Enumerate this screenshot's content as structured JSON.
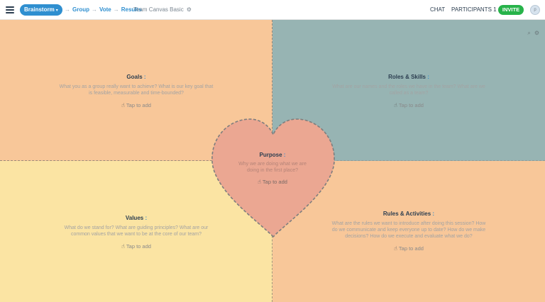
{
  "header": {
    "stage_label": "Brainstorm",
    "crumbs": [
      "Group",
      "Vote",
      "Results"
    ],
    "board_name": "Team Canvas Basic",
    "chat": "CHAT",
    "participants": "PARTICIPANTS 1",
    "invite": "INVITE",
    "avatar_initials": "p"
  },
  "sections": {
    "goals": {
      "title": "Goals",
      "desc": "What you as a group really want to achieve? What is our key goal that is feasible, measurable and time-bounded?",
      "tap": "Tap to add"
    },
    "roles": {
      "title": "Roles & Skills",
      "desc": "What are our names and the roles we have in the team? What are we called as a team?",
      "tap": "Tap to add"
    },
    "values": {
      "title": "Values",
      "desc": "What do we stand for? What are guiding principles? What are our common values that we want to be at the core of our team?",
      "tap": "Tap to add"
    },
    "rules": {
      "title": "Rules & Activities",
      "desc": "What are the rules we want to introduce after doing this session? How do we communicate and keep everyone up to date? How do we make decisions? How do we execute and evaluate what we do?",
      "tap": "Tap to add"
    },
    "purpose": {
      "title": "Purpose",
      "desc": "Why we are doing what we are doing in the first place?",
      "tap": "Tap to add"
    }
  },
  "colors": {
    "goals": "#f8c799",
    "roles": "#97b4b3",
    "values": "#fbe4a3",
    "rules": "#f8c799",
    "purpose": "#eba792",
    "accent": "#2f8fd0",
    "invite": "#27b34a"
  },
  "icons": {
    "menu": "hamburger-icon",
    "tap": "hand-pointer-icon",
    "search": "search-icon",
    "settings": "gear-icon"
  }
}
